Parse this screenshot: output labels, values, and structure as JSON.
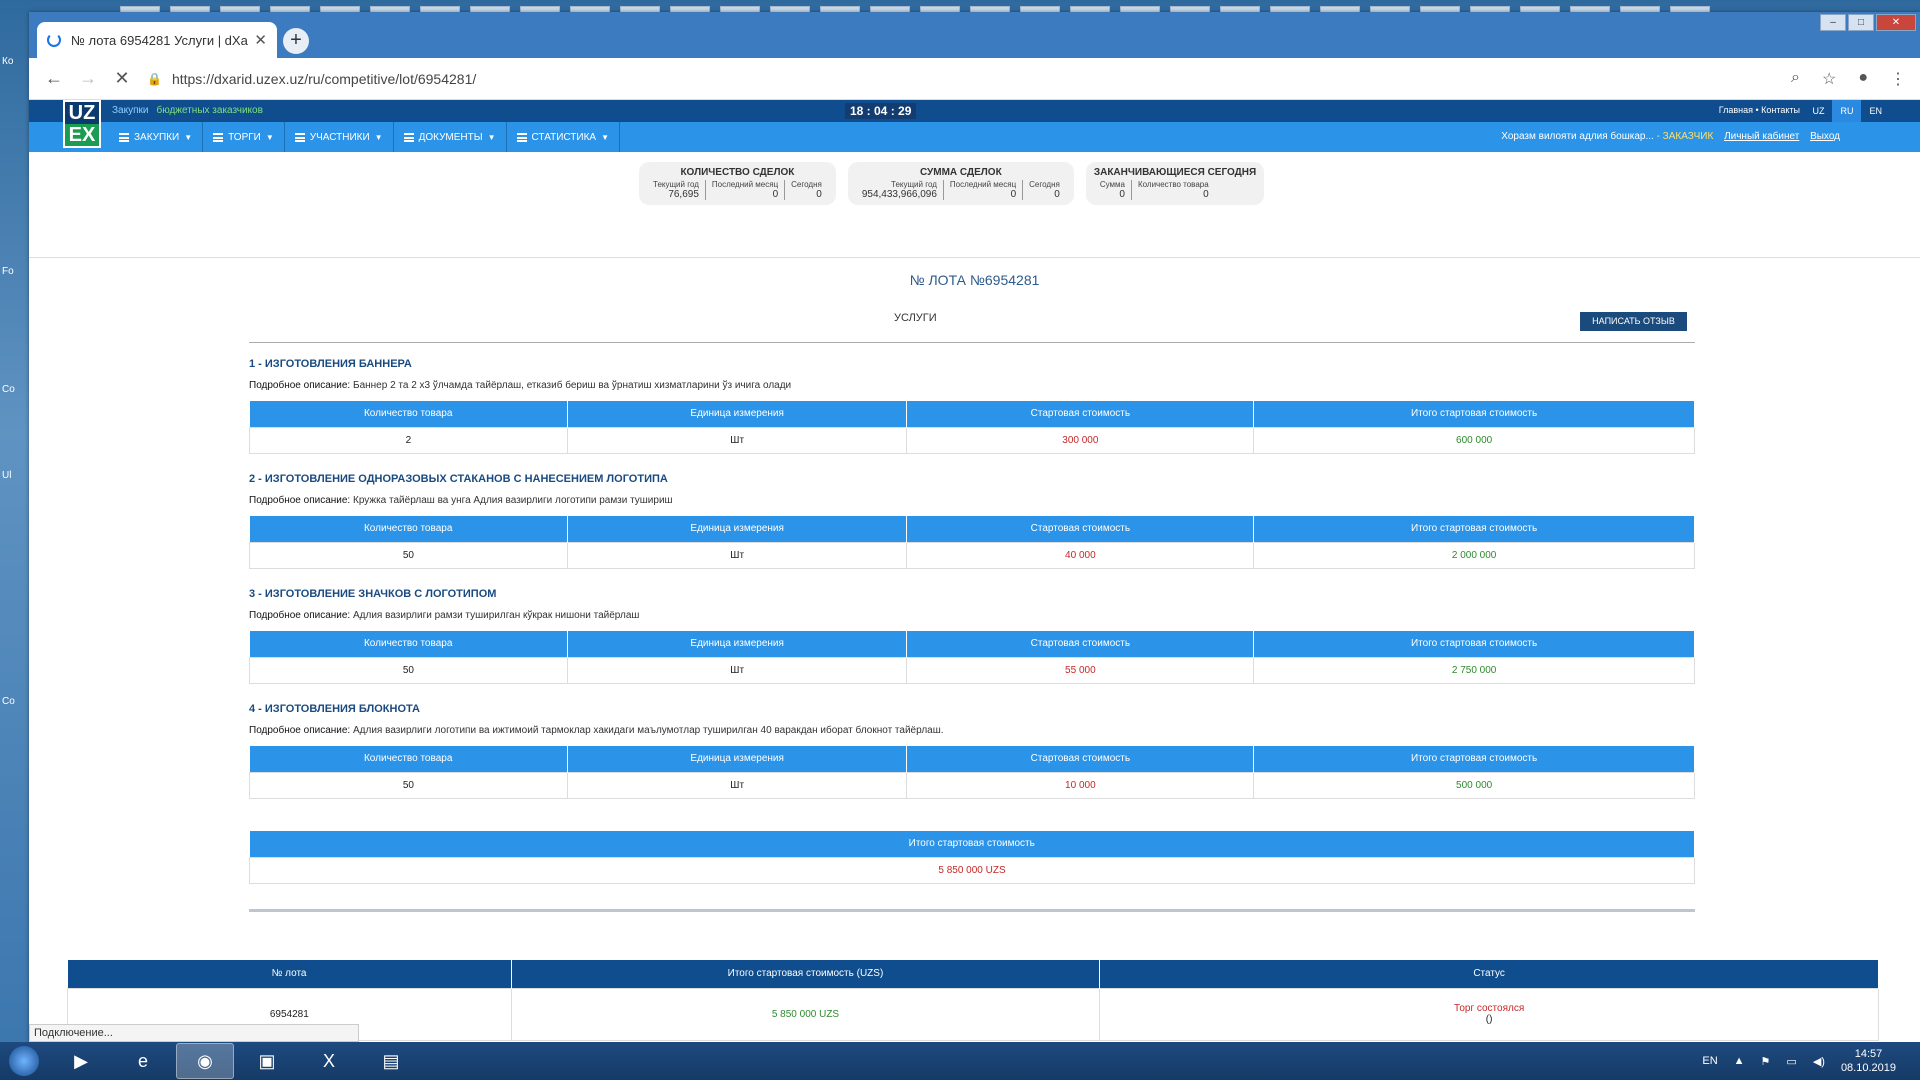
{
  "desktop": {
    "icons": [
      "Ко",
      "Fo",
      "Co",
      "Ul",
      "Co"
    ]
  },
  "browser": {
    "tab_title": "№ лота 6954281 Услуги | dXarid",
    "url_host": "https://dxarid.uzex.uz",
    "url_path": "/ru/competitive/lot/6954281/",
    "status_text": "Подключение..."
  },
  "site": {
    "logo_top": "UZ",
    "logo_bottom": "EX",
    "zakupki": "Закупки",
    "budget": "бюджетных заказчиков",
    "clock": "18 : 04 : 29",
    "top_links": "Главная  •  Контакты",
    "langs": [
      "UZ",
      "RU",
      "EN"
    ],
    "menu": [
      "ЗАКУПКИ",
      "ТОРГИ",
      "УЧАСТНИКИ",
      "ДОКУМЕНТЫ",
      "СТАТИСТИКА"
    ],
    "user_name": "Хоразм вилояти адлия бошкар...",
    "user_role": "- ЗАКАЗЧИК",
    "cabinet": "Личный кабинет",
    "logout": "Выход"
  },
  "stats": [
    {
      "title": "КОЛИЧЕСТВО СДЕЛОК",
      "cols": [
        {
          "label": "Текущий год",
          "value": "76,695"
        },
        {
          "label": "Последний месяц",
          "value": "0"
        },
        {
          "label": "Сегодня",
          "value": "0"
        }
      ]
    },
    {
      "title": "СУММА СДЕЛОК",
      "cols": [
        {
          "label": "Текущий год",
          "value": "954,433,966,096"
        },
        {
          "label": "Последний месяц",
          "value": "0"
        },
        {
          "label": "Сегодня",
          "value": "0"
        }
      ]
    },
    {
      "title": "ЗАКАНЧИВАЮЩИЕСЯ СЕГОДНЯ",
      "cols": [
        {
          "label": "Сумма",
          "value": "0"
        },
        {
          "label": "Количество товара",
          "value": "0"
        }
      ]
    }
  ],
  "lot": {
    "number": "№ ЛОТА №6954281",
    "category": "УСЛУГИ",
    "review_button": "НАПИСАТЬ ОТЗЫВ",
    "desc_label": "Подробное описание:",
    "headers": [
      "Количество товара",
      "Единица измерения",
      "Стартовая стоимость",
      "Итого стартовая стоимость"
    ],
    "items": [
      {
        "title": "1 - ИЗГОТОВЛЕНИЯ БАННЕРА",
        "desc": "Баннер 2 та 2 х3 ўлчамда тайёрлаш, етказиб бериш ва ўрнатиш хизматларини ўз ичига олади",
        "qty": "2",
        "unit": "Шт",
        "price": "300 000",
        "total": "600 000"
      },
      {
        "title": "2 - ИЗГОТОВЛЕНИЕ ОДНОРАЗОВЫХ СТАКАНОВ С НАНЕСЕНИЕМ ЛОГОТИПА",
        "desc": "Кружка тайёрлаш ва унга Адлия вазирлиги логотипи рамзи тушириш",
        "qty": "50",
        "unit": "Шт",
        "price": "40 000",
        "total": "2 000 000"
      },
      {
        "title": "3 - ИЗГОТОВЛЕНИЕ ЗНАЧКОВ С ЛОГОТИПОМ",
        "desc": "Адлия вазирлиги рамзи туширилган кўкрак нишони тайёрлаш",
        "qty": "50",
        "unit": "Шт",
        "price": "55 000",
        "total": "2 750 000"
      },
      {
        "title": "4 - ИЗГОТОВЛЕНИЯ БЛОКНОТА",
        "desc": "Адлия вазирлиги логотипи ва ижтимоий тармоклар хакидаги маълумотлар туширилган 40 варакдан иборат блокнот тайёрлаш.",
        "qty": "50",
        "unit": "Шт",
        "price": "10 000",
        "total": "500 000"
      }
    ],
    "total_header": "Итого стартовая стоимость",
    "total_value": "5 850 000 UZS"
  },
  "footer_table": {
    "headers": [
      "№ лота",
      "Итого стартовая стоимость (UZS)",
      "Статус"
    ],
    "lot": "6954281",
    "sum": "5 850 000 UZS",
    "status": "Торг состоялся",
    "status_sub": "()"
  },
  "taskbar": {
    "lang": "EN",
    "time": "14:57",
    "date": "08.10.2019"
  }
}
